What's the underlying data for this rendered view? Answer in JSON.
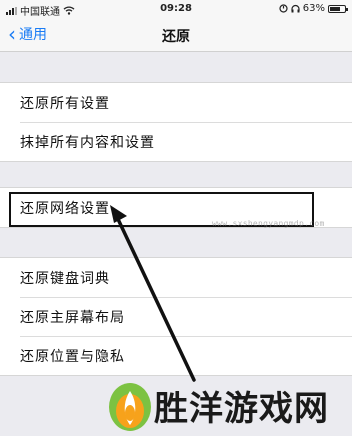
{
  "status_bar": {
    "carrier": "中国联通",
    "time": "09:28",
    "battery": "63%",
    "battery_level": 0.63
  },
  "nav": {
    "back_label": "通用",
    "title": "还原"
  },
  "groups": [
    {
      "items": [
        "还原所有设置",
        "抹掉所有内容和设置"
      ]
    },
    {
      "items": [
        "还原网络设置"
      ]
    },
    {
      "items": [
        "还原键盘词典",
        "还原主屏幕布局",
        "还原位置与隐私"
      ]
    }
  ],
  "watermark": {
    "url": "www.sxshengyangmdp.com",
    "text": "胜洋游戏网"
  }
}
